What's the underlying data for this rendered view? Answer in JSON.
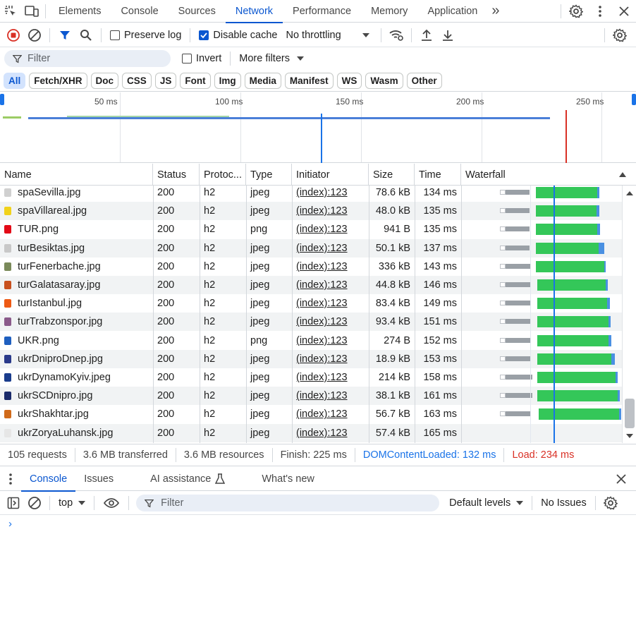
{
  "topbar": {
    "tabs": [
      "Elements",
      "Console",
      "Sources",
      "Network",
      "Performance",
      "Memory",
      "Application"
    ],
    "active_tab": "Network",
    "more_glyph": "»"
  },
  "toolbar": {
    "preserve_log_label": "Preserve log",
    "preserve_log_checked": false,
    "disable_cache_label": "Disable cache",
    "disable_cache_checked": true,
    "throttling_value": "No throttling"
  },
  "filter_row": {
    "filter_placeholder": "Filter",
    "invert_label": "Invert",
    "invert_checked": false,
    "more_filters_label": "More filters"
  },
  "type_chips": [
    "All",
    "Fetch/XHR",
    "Doc",
    "CSS",
    "JS",
    "Font",
    "Img",
    "Media",
    "Manifest",
    "WS",
    "Wasm",
    "Other"
  ],
  "active_chip": "All",
  "overview": {
    "ticks": [
      "50 ms",
      "100 ms",
      "150 ms",
      "200 ms",
      "250 ms"
    ]
  },
  "grid": {
    "columns": [
      "Name",
      "Status",
      "Protoc...",
      "Type",
      "Initiator",
      "Size",
      "Time",
      "Waterfall"
    ],
    "rows": [
      {
        "name": "spaSevilla.jpg",
        "status": "200",
        "protocol": "h2",
        "type": "jpeg",
        "initiator": "(index):123",
        "size": "78.6 kB",
        "time": "134 ms",
        "icon_color": "#d0d0d0"
      },
      {
        "name": "spaVillareal.jpg",
        "status": "200",
        "protocol": "h2",
        "type": "jpeg",
        "initiator": "(index):123",
        "size": "48.0 kB",
        "time": "135 ms",
        "icon_color": "#f1d21b"
      },
      {
        "name": "TUR.png",
        "status": "200",
        "protocol": "h2",
        "type": "png",
        "initiator": "(index):123",
        "size": "941 B",
        "time": "135 ms",
        "icon_color": "#e30a17"
      },
      {
        "name": "turBesiktas.jpg",
        "status": "200",
        "protocol": "h2",
        "type": "jpeg",
        "initiator": "(index):123",
        "size": "50.1 kB",
        "time": "137 ms",
        "icon_color": "#c8c8c8"
      },
      {
        "name": "turFenerbache.jpg",
        "status": "200",
        "protocol": "h2",
        "type": "jpeg",
        "initiator": "(index):123",
        "size": "336 kB",
        "time": "143 ms",
        "icon_color": "#7a8a5a"
      },
      {
        "name": "turGalatasaray.jpg",
        "status": "200",
        "protocol": "h2",
        "type": "jpeg",
        "initiator": "(index):123",
        "size": "44.8 kB",
        "time": "146 ms",
        "icon_color": "#c8501e"
      },
      {
        "name": "turIstanbul.jpg",
        "status": "200",
        "protocol": "h2",
        "type": "jpeg",
        "initiator": "(index):123",
        "size": "83.4 kB",
        "time": "149 ms",
        "icon_color": "#ee5a14"
      },
      {
        "name": "turTrabzonspor.jpg",
        "status": "200",
        "protocol": "h2",
        "type": "jpeg",
        "initiator": "(index):123",
        "size": "93.4 kB",
        "time": "151 ms",
        "icon_color": "#8a5a8a"
      },
      {
        "name": "UKR.png",
        "status": "200",
        "protocol": "h2",
        "type": "png",
        "initiator": "(index):123",
        "size": "274 B",
        "time": "152 ms",
        "icon_color": "#1f5fbf"
      },
      {
        "name": "ukrDniproDnep.jpg",
        "status": "200",
        "protocol": "h2",
        "type": "jpeg",
        "initiator": "(index):123",
        "size": "18.9 kB",
        "time": "153 ms",
        "icon_color": "#2a3a8a"
      },
      {
        "name": "ukrDynamoKyiv.jpeg",
        "status": "200",
        "protocol": "h2",
        "type": "jpeg",
        "initiator": "(index):123",
        "size": "214 kB",
        "time": "158 ms",
        "icon_color": "#1a3c8c"
      },
      {
        "name": "ukrSCDnipro.jpg",
        "status": "200",
        "protocol": "h2",
        "type": "jpeg",
        "initiator": "(index):123",
        "size": "38.1 kB",
        "time": "161 ms",
        "icon_color": "#1a2a6a"
      },
      {
        "name": "ukrShakhtar.jpg",
        "status": "200",
        "protocol": "h2",
        "type": "jpeg",
        "initiator": "(index):123",
        "size": "56.7 kB",
        "time": "163 ms",
        "icon_color": "#d06a1a"
      },
      {
        "name": "ukrZoryaLuhansk.jpg",
        "status": "200",
        "protocol": "h2",
        "type": "jpeg",
        "initiator": "(index):123",
        "size": "57.4 kB",
        "time": "165 ms",
        "icon_color": "#e6e6e6"
      }
    ]
  },
  "status_bar": {
    "requests": "105 requests",
    "transferred": "3.6 MB transferred",
    "resources": "3.6 MB resources",
    "finish": "Finish: 225 ms",
    "dom_content_loaded": "DOMContentLoaded: 132 ms",
    "load": "Load: 234 ms"
  },
  "drawer": {
    "tabs": [
      "Console",
      "Issues",
      "AI assistance",
      "What's new"
    ],
    "active_tab": "Console",
    "context": "top",
    "filter_placeholder": "Filter",
    "levels": "Default levels",
    "issues": "No Issues"
  },
  "colors": {
    "accent": "#0b57d0",
    "dcl_blue": "#1a73e8",
    "load_red": "#d93025",
    "waterfall_green": "#34a853",
    "waiting_gray": "#9aa0a6"
  }
}
